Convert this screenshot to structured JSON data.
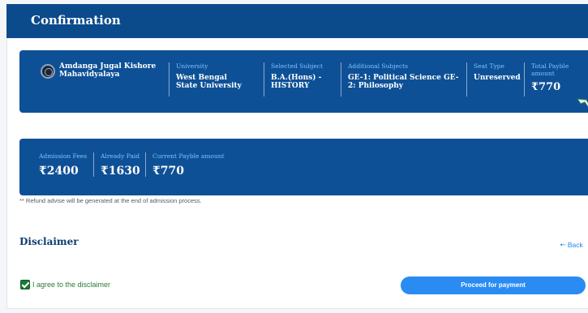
{
  "header": {
    "title": "Confirmation"
  },
  "summary": {
    "college": "Amdanga Jugal Kishore Mahavidyalaya",
    "university": {
      "label": "University",
      "value": "West Bengal State University"
    },
    "subject": {
      "label": "Selected Subject",
      "value": "B.A.(Hons) - HISTORY"
    },
    "additional": {
      "label": "Additional Subjects",
      "value": "GE-1: Political Science GE-2: Philosophy"
    },
    "seat": {
      "label": "Seat Type",
      "value": "Unreserved"
    },
    "total": {
      "label": "Total Payble amount",
      "value": "₹770"
    }
  },
  "fees": {
    "admission": {
      "label": "Admission Fees",
      "value": "₹2400"
    },
    "paid": {
      "label": "Already Paid",
      "value": "₹1630"
    },
    "current": {
      "label": "Current Payble amount",
      "value": "₹770"
    }
  },
  "refund_note": "** Refund advise will be generated at the end of admission process.",
  "disclaimer": {
    "title": "Disclaimer",
    "back_label": "Back"
  },
  "agree": {
    "label": "I agree to the disclaimer",
    "checked": true
  },
  "proceed_label": "Proceed for payment",
  "colors": {
    "header_bg": "#0b4a8b",
    "panel_bg": "#0e5096",
    "accent": "#2a8cf2",
    "label": "#7fc3ff",
    "check": "#1d7a3a"
  }
}
